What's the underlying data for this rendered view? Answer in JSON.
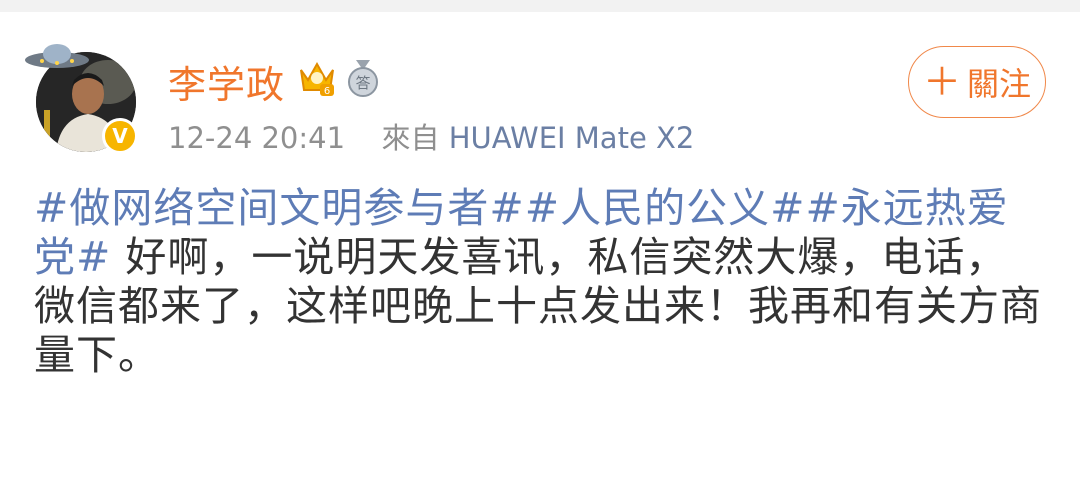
{
  "post": {
    "author": {
      "name": "李学政",
      "verified_mark": "V",
      "badges": [
        "crown-badge-icon",
        "medal-badge-icon"
      ],
      "crown_badge_level": "6",
      "medal_badge_char": "答"
    },
    "timestamp": "12-24 20:41",
    "source_prefix": "來自",
    "source_device": "HUAWEI Mate X2",
    "follow_button": {
      "icon": "＋",
      "label": "關注"
    },
    "topics": [
      "#做网络空间文明参与者#",
      "#人民的公义#",
      "#永远热爱党#"
    ],
    "body_text": " 好啊，一说明天发喜讯，私信突然大爆，电话，微信都来了，这样吧晚上十点发出来！我再和有关方商量下。"
  },
  "colors": {
    "username": "#f0762c",
    "topic_link": "#5e7cb6",
    "meta": "#8f8f8f",
    "source": "#6b7fa4",
    "body": "#333333",
    "follow_border": "#f0884a"
  }
}
